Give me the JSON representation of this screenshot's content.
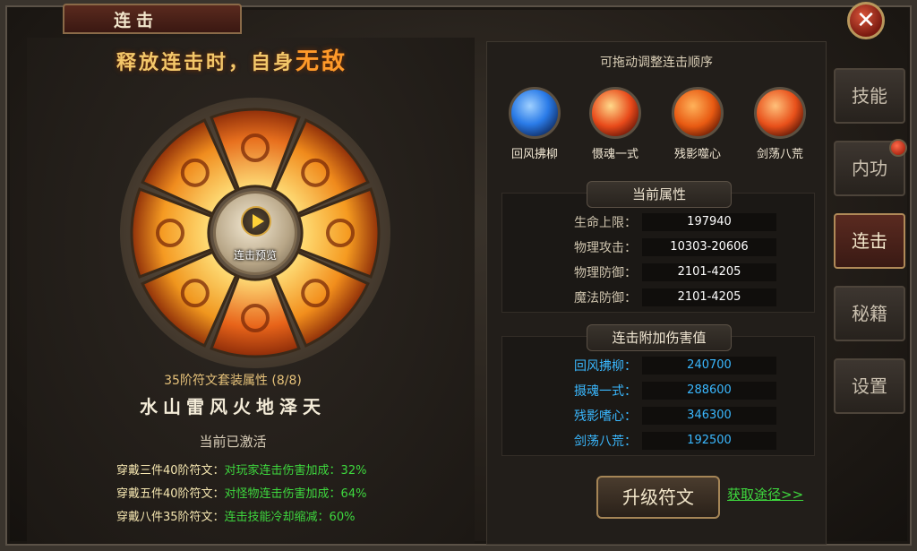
{
  "window": {
    "title": "连击"
  },
  "slogan": {
    "prefix": "释放连击时，自身",
    "emphasis": "无敌"
  },
  "wheel": {
    "preview_label": "连击预览",
    "segment_colors": [
      "#e8701e",
      "#f08a1c",
      "#f59a20",
      "#f28e1c",
      "#e8641a",
      "#f0961e",
      "#f59a22",
      "#f08c1e"
    ]
  },
  "rune_set": {
    "title": "35阶符文套装属性 (8/8)",
    "elements": "水山雷风火地泽天",
    "activated_title": "当前已激活",
    "bonuses": [
      {
        "key": "穿戴三件40阶符文：",
        "value": "对玩家连击伤害加成：32%"
      },
      {
        "key": "穿戴五件40阶符文：",
        "value": "对怪物连击伤害加成：64%"
      },
      {
        "key": "穿戴八件35阶符文：",
        "value": "连击技能冷却缩减：60%"
      }
    ]
  },
  "order_panel": {
    "title": "可拖动调整连击顺序",
    "skills": [
      {
        "name": "回风拂柳",
        "icon": "wind-slash-icon",
        "color": "#2a7be8"
      },
      {
        "name": "慑魂一式",
        "icon": "soul-strike-icon",
        "color": "#e84a1a"
      },
      {
        "name": "残影噬心",
        "icon": "shadow-bite-icon",
        "color": "#e85a12"
      },
      {
        "name": "剑荡八荒",
        "icon": "sword-sweep-icon",
        "color": "#e8501a"
      }
    ]
  },
  "attributes": {
    "header": "当前属性",
    "rows": [
      {
        "label": "生命上限：",
        "value": "197940"
      },
      {
        "label": "物理攻击：",
        "value": "10303-20606"
      },
      {
        "label": "物理防御：",
        "value": "2101-4205"
      },
      {
        "label": "魔法防御：",
        "value": "2101-4205"
      }
    ]
  },
  "damage": {
    "header": "连击附加伤害值",
    "rows": [
      {
        "label": "回风拂柳：",
        "value": "240700"
      },
      {
        "label": "摄魂一式：",
        "value": "288600"
      },
      {
        "label": "残影嗜心：",
        "value": "346300"
      },
      {
        "label": "剑荡八荒：",
        "value": "192500"
      }
    ]
  },
  "actions": {
    "upgrade": "升级符文",
    "obtain": "获取途径>>"
  },
  "tabs": [
    {
      "label": "技能",
      "active": false
    },
    {
      "label": "内功",
      "active": false
    },
    {
      "label": "连击",
      "active": true
    },
    {
      "label": "秘籍",
      "active": false
    },
    {
      "label": "设置",
      "active": false
    }
  ],
  "close_label": "✕"
}
